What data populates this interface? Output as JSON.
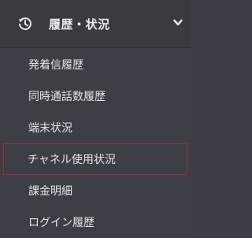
{
  "group": {
    "title": "履歴・状況",
    "icon": "history-icon",
    "chevron": "chevron-down-icon",
    "expanded": true
  },
  "menu": {
    "items": [
      {
        "label": "発着信履歴",
        "selected": false
      },
      {
        "label": "同時通話数履歴",
        "selected": false
      },
      {
        "label": "端末状況",
        "selected": false
      },
      {
        "label": "チャネル使用状況",
        "selected": true
      },
      {
        "label": "課金明細",
        "selected": false
      },
      {
        "label": "ログイン履歴",
        "selected": false
      }
    ]
  },
  "colors": {
    "background": "#3c4046",
    "header_background": "#383c41",
    "text": "#e3e4e6",
    "selection_border": "#b3222a"
  }
}
